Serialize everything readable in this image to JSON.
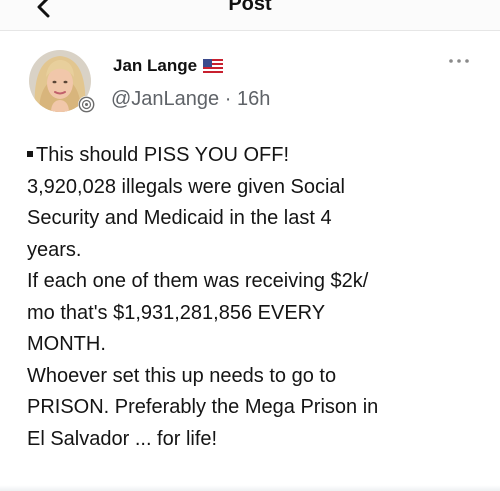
{
  "header": {
    "title": "Post",
    "back_icon": "chevron-left-icon"
  },
  "author": {
    "name": "Jan Lange",
    "flag_icon": "us-flag-icon",
    "handle": "@JanLange",
    "separator": "·",
    "time": "16h",
    "more_icon": "more-horizontal-icon"
  },
  "post": {
    "lines": [
      "This should PISS YOU OFF!",
      "3,920,028 illegals were given Social",
      "Security and Medicaid in the last 4",
      "years.",
      "If each one of them was receiving $2k/",
      "mo that's $1,931,281,856 EVERY",
      "MONTH.",
      "Whoever set this up needs to go to",
      "PRISON. Preferably the Mega Prison in",
      "El Salvador ... for life!"
    ]
  },
  "colors": {
    "text": "#141414",
    "secondary": "#5f6368",
    "divider": "#e6e6e6"
  }
}
